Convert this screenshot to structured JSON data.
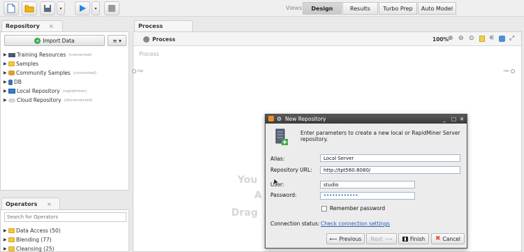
{
  "toolbar": {
    "views_label": "Views:",
    "view_tabs": [
      "Design",
      "Results",
      "Turbo Prep",
      "Auto Model"
    ]
  },
  "repository": {
    "tab_label": "Repository",
    "import_label": "Import Data",
    "menu_label": "≡ ▾",
    "items": [
      {
        "label": "Training Resources",
        "note": "(connected)"
      },
      {
        "label": "Samples",
        "note": ""
      },
      {
        "label": "Community Samples",
        "note": "(connected)"
      },
      {
        "label": "DB",
        "note": ""
      },
      {
        "label": "Local Repository",
        "note": "(rapidminer)"
      },
      {
        "label": "Cloud Repository",
        "note": "(disconnected)"
      }
    ]
  },
  "operators": {
    "tab_label": "Operators",
    "search_placeholder": "Search for Operators",
    "items": [
      {
        "label": "Data Access (50)"
      },
      {
        "label": "Blending (77)"
      },
      {
        "label": "Cleansing (25)"
      }
    ]
  },
  "process": {
    "tab_label": "Process",
    "breadcrumb": "Process",
    "zoom": "100%",
    "canvas_label": "Process",
    "port_in": "inp",
    "port_out": "res",
    "watermark_lines": [
      "You",
      "A",
      "Drag"
    ]
  },
  "dialog": {
    "title": "New Repository",
    "description": "Enter parameters to create a new local or RapidMiner Server repository.",
    "alias_label": "Alias:",
    "alias_value": "Local Server",
    "url_label": "Repository URL:",
    "url_value": "http://tpt560:8080/",
    "user_label": "User:",
    "user_value": "studio",
    "password_label": "Password:",
    "password_value": "••••••••••••",
    "remember_label": "Remember password",
    "status_label": "Connection status:",
    "status_link": "Check connection settings",
    "buttons": {
      "previous": "Previous",
      "next": "Next",
      "finish": "Finish",
      "cancel": "Cancel"
    }
  }
}
